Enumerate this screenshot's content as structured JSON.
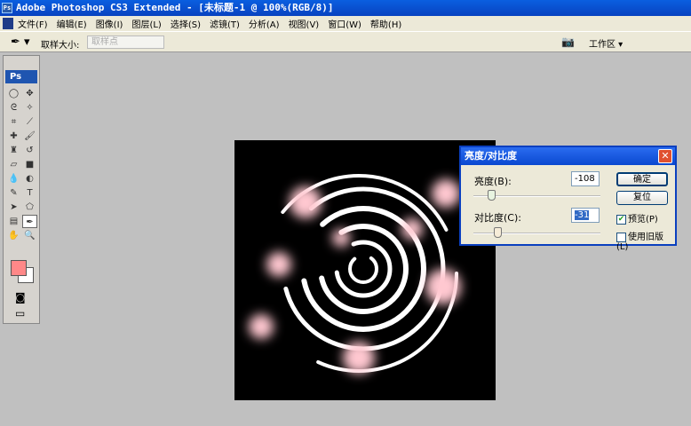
{
  "title": "Adobe Photoshop CS3 Extended - [未标题-1 @ 100%(RGB/8)]",
  "menu": [
    "文件(F)",
    "编辑(E)",
    "图像(I)",
    "图层(L)",
    "选择(S)",
    "滤镜(T)",
    "分析(A)",
    "视图(V)",
    "窗口(W)",
    "帮助(H)"
  ],
  "options": {
    "sample_size_label": "取样大小:",
    "sample_size_value": "取样点",
    "workspace": "工作区 ▾"
  },
  "tools": {
    "logo": "Ps",
    "foreground_color": "#ff8888",
    "background_color": "#ffffff"
  },
  "dialog": {
    "title": "亮度/对比度",
    "brightness_label": "亮度(B):",
    "brightness_value": "-108",
    "brightness_fraction": 0.14,
    "contrast_label": "对比度(C):",
    "contrast_value": "-31",
    "contrast_fraction": 0.19,
    "ok": "确定",
    "reset": "复位",
    "preview_label": "预览(P)",
    "preview_checked": true,
    "legacy_label": "使用旧版(L)",
    "legacy_checked": false
  }
}
